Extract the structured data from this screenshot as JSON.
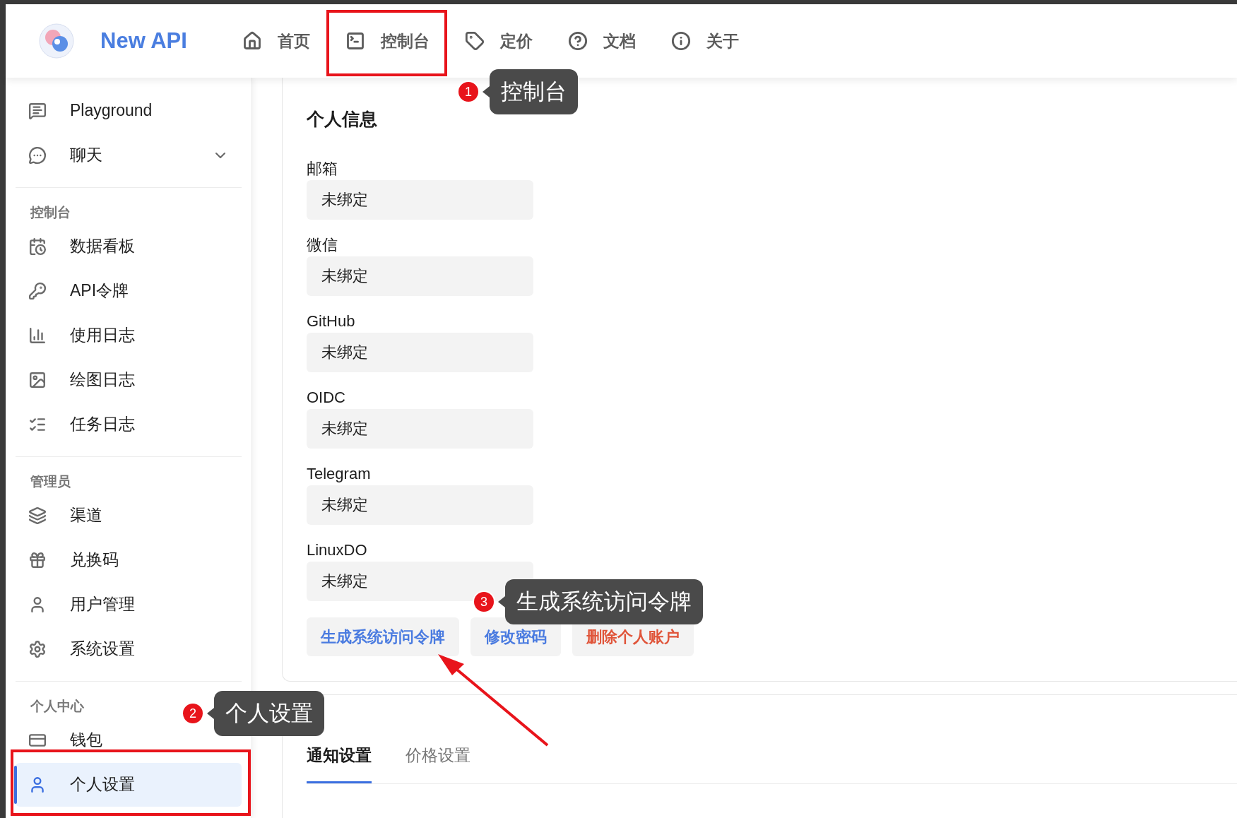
{
  "header": {
    "app_name": "New API",
    "nav": [
      {
        "label": "首页"
      },
      {
        "label": "控制台"
      },
      {
        "label": "定价"
      },
      {
        "label": "文档"
      },
      {
        "label": "关于"
      }
    ]
  },
  "sidebar": {
    "groups": [
      {
        "items": [
          {
            "label": "Playground",
            "selected": false
          },
          {
            "label": "聊天",
            "selected": false,
            "expanded": false
          }
        ]
      },
      {
        "title": "控制台",
        "items": [
          {
            "label": "数据看板",
            "selected": false
          },
          {
            "label": "API令牌",
            "selected": false
          },
          {
            "label": "使用日志",
            "selected": false
          },
          {
            "label": "绘图日志",
            "selected": false
          },
          {
            "label": "任务日志",
            "selected": false
          }
        ]
      },
      {
        "title": "管理员",
        "items": [
          {
            "label": "渠道",
            "selected": false
          },
          {
            "label": "兑换码",
            "selected": false
          },
          {
            "label": "用户管理",
            "selected": false
          },
          {
            "label": "系统设置",
            "selected": false
          }
        ]
      },
      {
        "title": "个人中心",
        "items": [
          {
            "label": "钱包",
            "selected": false
          },
          {
            "label": "个人设置",
            "selected": true
          }
        ]
      }
    ]
  },
  "profile": {
    "title": "个人信息",
    "fields": [
      {
        "label": "邮箱",
        "value": "未绑定"
      },
      {
        "label": "微信",
        "value": "未绑定"
      },
      {
        "label": "GitHub",
        "value": "未绑定"
      },
      {
        "label": "OIDC",
        "value": "未绑定"
      },
      {
        "label": "Telegram",
        "value": "未绑定"
      },
      {
        "label": "LinuxDO",
        "value": "未绑定"
      }
    ],
    "buttons": [
      {
        "label": "生成系统访问令牌",
        "kind": "primary"
      },
      {
        "label": "修改密码",
        "kind": "primary"
      },
      {
        "label": "删除个人账户",
        "kind": "danger"
      }
    ]
  },
  "settings_tabs": [
    {
      "label": "通知设置",
      "selected": true
    },
    {
      "label": "价格设置",
      "selected": false
    }
  ],
  "annotations": [
    {
      "number": "1",
      "text": "控制台"
    },
    {
      "number": "2",
      "text": "个人设置"
    },
    {
      "number": "3",
      "text": "生成系统访问令牌"
    }
  ]
}
